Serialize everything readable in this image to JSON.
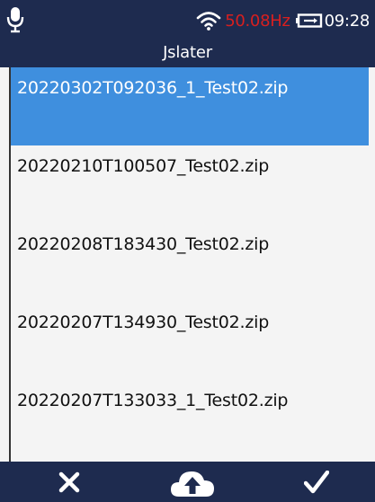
{
  "status_bar": {
    "frequency": "50.08Hz",
    "time": "09:28",
    "frequency_color": "#d81f1f",
    "icons": [
      "microphone-icon",
      "wifi-icon",
      "battery-icon"
    ]
  },
  "header": {
    "title": "Jslater"
  },
  "files": [
    {
      "name": "20220302T092036_1_Test02.zip",
      "selected": true
    },
    {
      "name": "20220210T100507_Test02.zip",
      "selected": false
    },
    {
      "name": "20220208T183430_Test02.zip",
      "selected": false
    },
    {
      "name": "20220207T134930_Test02.zip",
      "selected": false
    },
    {
      "name": "20220207T133033_1_Test02.zip",
      "selected": false
    }
  ],
  "toolbar": {
    "buttons": [
      "close-icon",
      "cloud-upload-icon",
      "checkmark-icon"
    ]
  },
  "colors": {
    "bar_background": "#1e2b4f",
    "selection": "#3f8fde",
    "list_background": "#f4f4f4"
  }
}
